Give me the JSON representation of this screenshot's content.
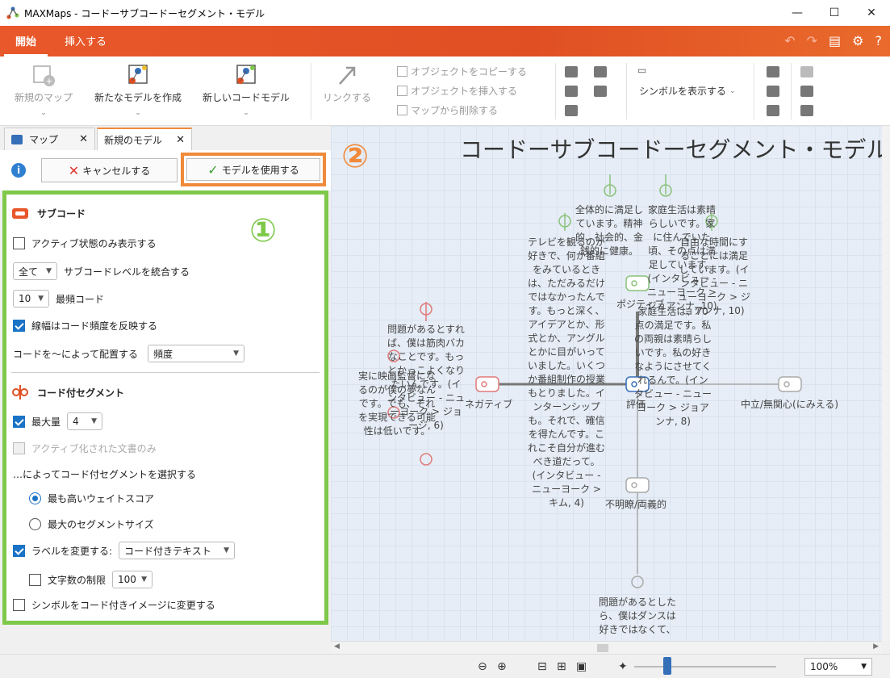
{
  "window": {
    "title": "MAXMaps - コードーサブコードーセグメント・モデル",
    "controls": [
      "—",
      "☐",
      "✕"
    ]
  },
  "menu": {
    "tabs": [
      "開始",
      "挿入する"
    ]
  },
  "ribbon": {
    "new_map": "新規のマップ",
    "new_model": "新たなモデルを作成",
    "new_code_model": "新しいコードモデル",
    "link": "リンクする",
    "copy_object": "オブジェクトをコピーする",
    "insert_object": "オブジェクトを挿入する",
    "delete_from_map": "マップから削除する",
    "show_symbol": "シンボルを表示する"
  },
  "tabs": {
    "map": "マップ",
    "new_model": "新規のモデル"
  },
  "actions": {
    "info": "i",
    "cancel": "キャンセルする",
    "use_model": "モデルを使用する"
  },
  "callouts": {
    "one": "①",
    "two": "②"
  },
  "panel": {
    "subcode_header": "サブコード",
    "active_only": "アクティブ状態のみ表示する",
    "level_value": "全て",
    "level_label": "サブコードレベルを統合する",
    "top_value": "10",
    "top_label": "最頻コード",
    "line_width": "線幅はコード頻度を反映する",
    "arrange_label": "コードを～によって配置する",
    "arrange_value": "頻度",
    "segment_header": "コード付セグメント",
    "max_label": "最大量",
    "max_value": "4",
    "active_docs": "アクティブ化された文書のみ",
    "select_by": "…によってコード付セグメントを選択する",
    "opt_weight": "最も高いウェイトスコア",
    "opt_size": "最大のセグメントサイズ",
    "change_label": "ラベルを変更する:",
    "change_value": "コード付きテキスト",
    "char_limit": "文字数の制限",
    "char_value": "100",
    "symbol_change": "シンボルをコード付きイメージに変更する"
  },
  "canvas": {
    "title": "コードーサブコードーセグメント・モデル",
    "codes": {
      "negative": "ネガティブ",
      "rating": "評価",
      "neutral": "中立/無関心(にみえる)",
      "unclear": "不明瞭/両義的",
      "positive": "ポジティブ"
    },
    "segments": [
      "全体的に満足しています。精神的、社会的、金銭的に健康。",
      "家庭生活は素晴らしいです。家に住んでいた頃、その点は満足しています。(インタビュー - ニューヨーク > ジョアンナ, 10)",
      "自由な時間にすることには満足しています。(インタビュー - ニューヨーク > ジョアンナ, 10)",
      "テレビを観るのが好きで、何か番組をみているときは、ただみるだけではなかったんです。もっと深く、アイデアとか、形式とか、アングルとかに目がいっていました。いくつか番組制作の授業もとりました。インターンシップも。それで、確信を得たんです。これこそ自分が進むべき道だって。(インタビュー - ニューヨーク > キム, 4)",
      "家庭生活は、70点の満足です。私の両親は素晴らしいです。私の好きなようにさせてくれるんで。(インタビュー - ニューヨーク > ジョアンナ, 8)",
      "問題があるとすれば、僕は筋肉バカなことです。もっとかっこよくなりたいんです。(インタビュー - ニューヨーク > ジョージ, 6)",
      "実に映画監督になるのが僕の夢なんです。でも、それを実現できる可能性は低いです。",
      "問題があるとしたら、僕はダンスは好きではなくて、"
    ]
  },
  "status": {
    "zoom": "100%",
    "zoom_fraction": 0.2
  },
  "colors": {
    "accent": "#e8582a",
    "panel_border": "#7ec84a",
    "callout_orange": "#f08a3a",
    "code_red": "#e07a7a",
    "code_green": "#8ac27a",
    "code_gray": "#aaaaaa",
    "code_blue": "#356fb8"
  }
}
